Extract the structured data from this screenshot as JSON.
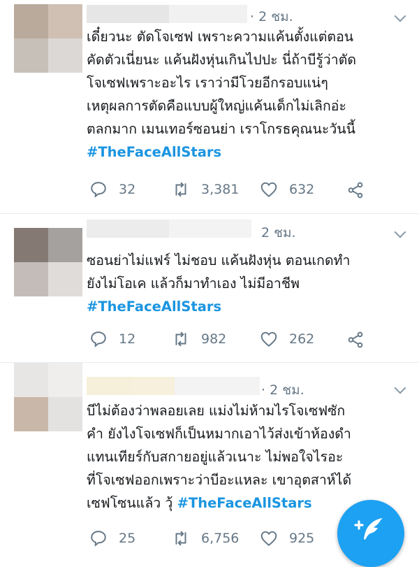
{
  "tweets": [
    {
      "time": "· 2 ชม.",
      "lines": [
        "เดี๋ยวนะ ตัดโจเซฟ เพราะความแค้นตั้งแต่ตอน",
        "คัดตัวเนี่ยนะ แค้นฝังหุ่นเกินไปปะ นี่ถ้าบีรู้ว่าตัด",
        "โจเซฟเพราะอะไร เราว่ามีโวยอีกรอบแน่ๆ",
        "เหตุผลการตัดคือแบบผู้ใหญ่แค้นเด็กไม่เลิกอ่ะ",
        "ตลกมาก เมนเทอร์ซอนย่า เราโกรธคุณนะวันนี้"
      ],
      "hashtag": "#TheFaceAllStars",
      "replies": "32",
      "retweets": "3,381",
      "likes": "632"
    },
    {
      "time": "2 ชม.",
      "lines": [
        "ซอนย่าไม่แฟร์ ไม่ชอบ แค้นฝังหุ่น ตอนเกดทำ",
        "ยังไม่โอเค แล้วก็มาทำเอง ไม่มีอาชีพ"
      ],
      "hashtag": "#TheFaceAllStars",
      "replies": "12",
      "retweets": "982",
      "likes": "262"
    },
    {
      "time": "· 2 ชม.",
      "lines": [
        "บีไม่ต้องว่าพลอยเลย แม่งไม่ห้ามไรโจเซฟซัก",
        "คำ ยังไงโจเซฟก็เป็นหมากเอาไว้ส่งเข้าห้องดำ",
        "แทนเทียร์กับสกายอยู่แล้วเนาะ ไม่พอใจไรอะ",
        "ที่โจเซฟออกเพราะว่าบีอะแหละ เขาอุตสาห์ได้"
      ],
      "last_line_prefix": "เซฟโซนแล้ว วุ้ ",
      "hashtag": "#TheFaceAllStars",
      "replies": "25",
      "retweets": "6,756",
      "likes": "925"
    }
  ],
  "icons": {
    "reply": "reply-icon",
    "retweet": "retweet-icon",
    "like": "heart-icon",
    "share": "share-icon",
    "menu": "chevron-down-icon",
    "compose": "compose-tweet-icon"
  },
  "colors": {
    "accent": "#1da1f2",
    "hashtag": "#1b95e0",
    "muted": "#657786"
  }
}
